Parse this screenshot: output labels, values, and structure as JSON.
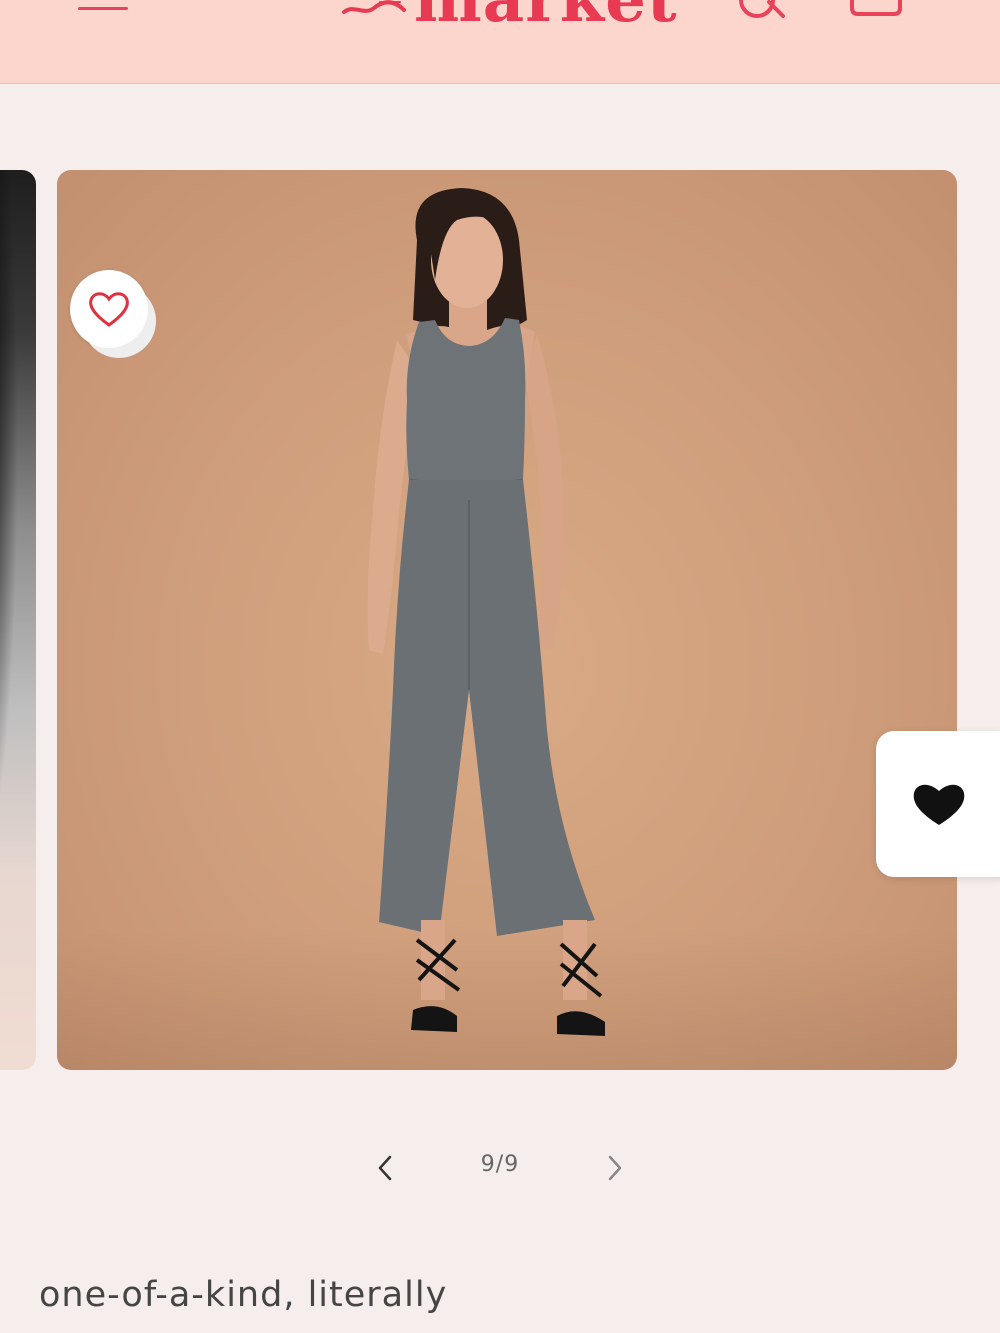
{
  "header": {
    "brand": "market",
    "menu_icon": "hamburger-menu-icon",
    "search_icon": "search-icon",
    "cart_icon": "shopping-bag-icon",
    "background_color": "#fcd5cd",
    "brand_color": "#e83a52"
  },
  "gallery": {
    "favorite_icon": "heart-outline-icon",
    "favorite_color": "#e0313f",
    "product_image": "woman in grey sleeveless wide-leg jumpsuit with black strappy sandals on tan background"
  },
  "side_tab": {
    "icon": "heart-filled-icon"
  },
  "pager": {
    "count": "9/9",
    "prev_icon": "chevron-left-icon",
    "next_icon": "chevron-right-icon"
  },
  "tagline": "one-of-a-kind, literally"
}
